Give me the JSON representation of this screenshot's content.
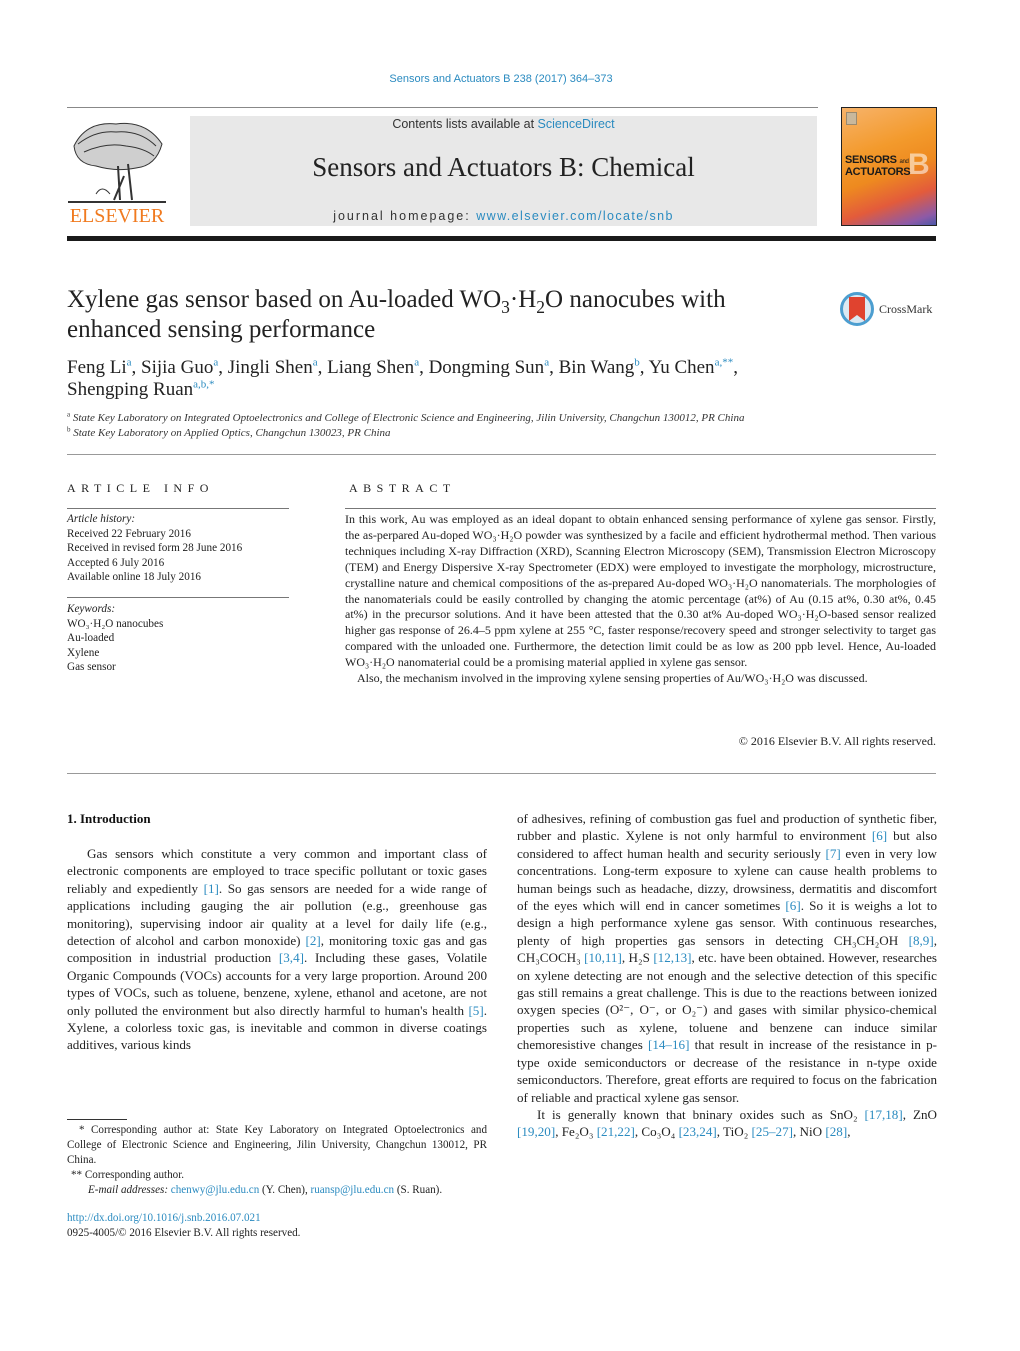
{
  "header": {
    "journal_ref": "Sensors and Actuators B 238 (2017) 364–373",
    "contents_prefix": "Contents lists available at ",
    "contents_link": "ScienceDirect",
    "journal_title": "Sensors and Actuators B: Chemical",
    "homepage_prefix": "journal homepage: ",
    "homepage_link": "www.elsevier.com/locate/snb",
    "publisher_logo_text": "ELSEVIER",
    "cover": {
      "line1": "SENSORS",
      "line1_small": "and",
      "line2": "ACTUATORS",
      "letter": "B"
    },
    "colors": {
      "link": "#2b8bc0",
      "elsevier_orange": "#f07a1f",
      "band": "#e8e8e8"
    }
  },
  "title": {
    "part1": "Xylene gas sensor based on Au-loaded WO",
    "sub1": "3",
    "part2": "·H",
    "sub2": "2",
    "part3": "O nanocubes with enhanced sensing performance"
  },
  "crossmark_label": "CrossMark",
  "authors": [
    {
      "name": "Feng Li",
      "aff": "a"
    },
    {
      "name": "Sijia Guo",
      "aff": "a"
    },
    {
      "name": "Jingli Shen",
      "aff": "a"
    },
    {
      "name": "Liang Shen",
      "aff": "a"
    },
    {
      "name": "Dongming Sun",
      "aff": "a"
    },
    {
      "name": "Bin Wang",
      "aff": "b"
    },
    {
      "name": "Yu Chen",
      "aff": "a,**"
    },
    {
      "name": "Shengping Ruan",
      "aff": "a,b,*"
    }
  ],
  "affiliations": [
    {
      "mark": "a",
      "text": "State Key Laboratory on Integrated Optoelectronics and College of Electronic Science and Engineering, Jilin University, Changchun 130012, PR China"
    },
    {
      "mark": "b",
      "text": "State Key Laboratory on Applied Optics, Changchun 130023, PR China"
    }
  ],
  "article_info": {
    "heading": "ARTICLE INFO",
    "history_label": "Article history:",
    "history": [
      "Received 22 February 2016",
      "Received in revised form 28 June 2016",
      "Accepted 6 July 2016",
      "Available online 18 July 2016"
    ],
    "keywords_label": "Keywords:",
    "keywords": [
      "WO₃·H₂O nanocubes",
      "Au-loaded",
      "Xylene",
      "Gas sensor"
    ]
  },
  "abstract": {
    "heading": "ABSTRACT",
    "p1": "In this work, Au was employed as an ideal dopant to obtain enhanced sensing performance of xylene gas sensor. Firstly, the as-perpared Au-doped WO₃·H₂O powder was synthesized by a facile and efficient hydrothermal method. Then various techniques including X-ray Diffraction (XRD), Scanning Electron Microscopy (SEM), Transmission Electron Microscopy (TEM) and Energy Dispersive X-ray Spectrometer (EDX) were employed to investigate the morphology, microstructure, crystalline nature and chemical compositions of the as-prepared Au-doped WO₃·H₂O nanomaterials. The morphologies of the nanomaterials could be easily controlled by changing the atomic percentage (at%) of Au (0.15 at%, 0.30 at%, 0.45 at%) in the precursor solutions. And it have been attested that the 0.30 at% Au-doped WO₃·H₂O-based sensor realized higher gas response of 26.4–5 ppm xylene at 255 °C, faster response/recovery speed and stronger selectivity to target gas compared with the unloaded one. Furthermore, the detection limit could be as low as 200 ppb level. Hence, Au-loaded WO₃·H₂O nanomaterial could be a promising material applied in xylene gas sensor.",
    "p2": "Also, the mechanism involved in the improving xylene sensing properties of Au/WO₃·H₂O was discussed.",
    "copyright": "© 2016 Elsevier B.V. All rights reserved."
  },
  "body": {
    "section_heading": "1.  Introduction",
    "left": [
      {
        "t": "Gas sensors which constitute a very common and important class of electronic components are employed to trace specific pollutant or toxic gases reliably and expediently "
      },
      {
        "ref": "[1]"
      },
      {
        "t": ". So gas sensors are needed for a wide range of applications including gauging the air pollution (e.g., greenhouse gas monitoring), supervising indoor air quality at a level for daily life (e.g., detection of alcohol and carbon monoxide) "
      },
      {
        "ref": "[2]"
      },
      {
        "t": ", monitoring toxic gas and gas composition in industrial production "
      },
      {
        "ref": "[3,4]"
      },
      {
        "t": ". Including these gases, Volatile Organic Compounds (VOCs) accounts for a very large proportion. Around 200 types of VOCs, such as toluene, benzene, xylene, ethanol and acetone, are not only polluted the environment but also directly harmful to human's health "
      },
      {
        "ref": "[5]"
      },
      {
        "t": ". Xylene, a colorless toxic gas, is inevitable and common in diverse coatings additives, various kinds"
      }
    ],
    "right_p1": [
      {
        "t": "of adhesives, refining of combustion gas fuel and production of synthetic fiber, rubber and plastic. Xylene is not only harmful to environment "
      },
      {
        "ref": "[6]"
      },
      {
        "t": " but also considered to affect human health and security seriously "
      },
      {
        "ref": "[7]"
      },
      {
        "t": " even in very low concentrations. Long-term exposure to xylene can cause health problems to human beings such as headache, dizzy, drowsiness, dermatitis and discomfort of the eyes which will end in cancer sometimes "
      },
      {
        "ref": "[6]"
      },
      {
        "t": ". So it is weighs a lot to design a high performance xylene gas sensor. With continuous researches, plenty of high properties gas sensors in detecting CH₃CH₂OH "
      },
      {
        "ref": "[8,9]"
      },
      {
        "t": ", CH₃COCH₃ "
      },
      {
        "ref": "[10,11]"
      },
      {
        "t": ", H₂S "
      },
      {
        "ref": "[12,13]"
      },
      {
        "t": ", etc. have been obtained. However, researches on xylene detecting are not enough and the selective detection of this specific gas still remains a great challenge. This is due to the reactions between ionized oxygen species (O²⁻, O⁻, or O₂⁻) and gases with similar physico-chemical properties such as xylene, toluene and benzene can induce similar chemoresistive changes "
      },
      {
        "ref": "[14–16]"
      },
      {
        "t": " that result in increase of the resistance in p-type oxide semiconductors or decrease of the resistance in n-type oxide semiconductors. Therefore, great efforts are required to focus on the fabrication of reliable and practical xylene gas sensor."
      }
    ],
    "right_p2": [
      {
        "t": "It is generally known that bninary oxides such as SnO₂ "
      },
      {
        "ref": "[17,18]"
      },
      {
        "t": ", ZnO "
      },
      {
        "ref": "[19,20]"
      },
      {
        "t": ", Fe₂O₃ "
      },
      {
        "ref": "[21,22]"
      },
      {
        "t": ", Co₃O₄ "
      },
      {
        "ref": "[23,24]"
      },
      {
        "t": ", TiO₂ "
      },
      {
        "ref": "[25–27]"
      },
      {
        "t": ", NiO "
      },
      {
        "ref": "[28]"
      },
      {
        "t": ","
      }
    ]
  },
  "footnotes": {
    "star": "*  Corresponding author at: State Key Laboratory on Integrated Optoelectronics and College of Electronic Science and Engineering, Jilin University, Changchun 130012, PR China.",
    "double_star": "**  Corresponding author.",
    "email_label": "E-mail addresses: ",
    "email1": "chenwy@jlu.edu.cn",
    "email1_who": " (Y. Chen), ",
    "email2": "ruansp@jlu.edu.cn",
    "email2_who": " (S. Ruan).",
    "doi": "http://dx.doi.org/10.1016/j.snb.2016.07.021",
    "issn": "0925-4005/© 2016 Elsevier B.V. All rights reserved."
  }
}
